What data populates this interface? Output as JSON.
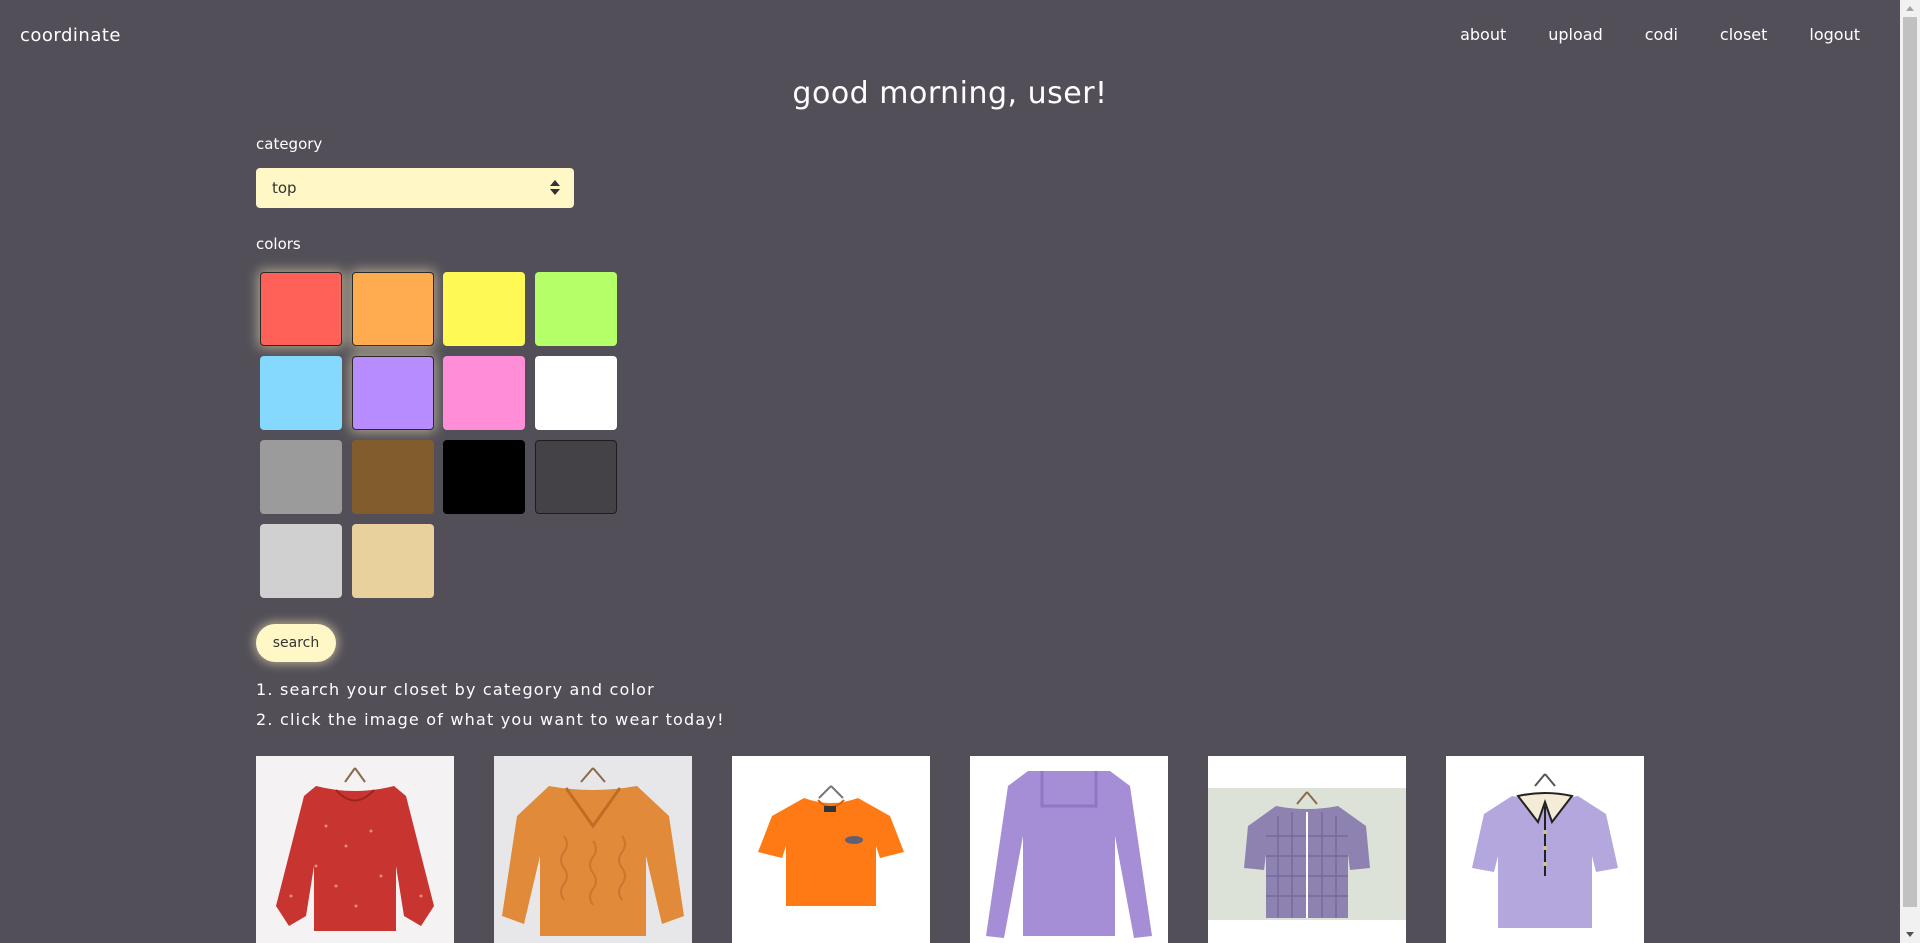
{
  "app": {
    "logo": "coordinate"
  },
  "nav": {
    "items": [
      "about",
      "upload",
      "codi",
      "closet",
      "logout"
    ]
  },
  "greeting": "good morning, user!",
  "filters": {
    "category_label": "category",
    "category_value": "top",
    "colors_label": "colors",
    "colors": [
      {
        "name": "red",
        "hex": "#ff6159",
        "selected": true
      },
      {
        "name": "orange",
        "hex": "#ffab50",
        "selected": true
      },
      {
        "name": "yellow",
        "hex": "#fff955",
        "selected": false
      },
      {
        "name": "green",
        "hex": "#b5ff68",
        "selected": false
      },
      {
        "name": "skyblue",
        "hex": "#85d9ff",
        "selected": false
      },
      {
        "name": "purple",
        "hex": "#b78cff",
        "selected": true
      },
      {
        "name": "pink",
        "hex": "#ff8dd7",
        "selected": false
      },
      {
        "name": "white",
        "hex": "#ffffff",
        "selected": false
      },
      {
        "name": "gray",
        "hex": "#9b9b9b",
        "selected": false
      },
      {
        "name": "brown",
        "hex": "#825c2c",
        "selected": false
      },
      {
        "name": "black",
        "hex": "#000000",
        "selected": false
      },
      {
        "name": "charcoal",
        "hex": "#444147",
        "selected": false
      },
      {
        "name": "lightgray",
        "hex": "#d0d0d0",
        "selected": false
      },
      {
        "name": "beige",
        "hex": "#e8d19d",
        "selected": false
      }
    ],
    "search_label": "search"
  },
  "instructions": {
    "step1": "1. search your closet by category and color",
    "step2": "2. click the image of what you want to wear today!"
  },
  "results": [
    {
      "name": "red-blouse",
      "color": "#c8342f"
    },
    {
      "name": "orange-knit-sweater",
      "color": "#e08a3a"
    },
    {
      "name": "orange-tshirt",
      "color": "#ff7a14"
    },
    {
      "name": "purple-longsleeve",
      "color": "#a58ed6"
    },
    {
      "name": "purple-check-blouse",
      "color": "#8e82b0"
    },
    {
      "name": "lavender-polo",
      "color": "#b3a7de"
    }
  ],
  "theme": {
    "background": "#524f58",
    "accent": "#fff7c6"
  }
}
